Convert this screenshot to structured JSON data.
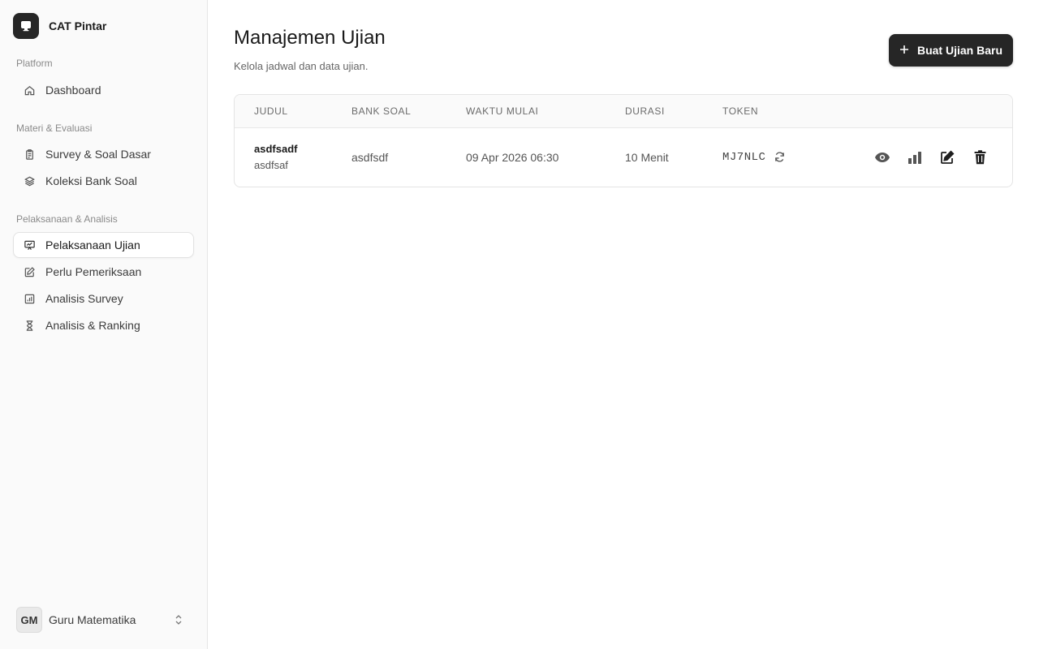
{
  "app": {
    "name": "CAT Pintar"
  },
  "sidebar": {
    "sections": [
      {
        "title": "Platform",
        "items": [
          {
            "label": "Dashboard",
            "icon": "home-icon"
          }
        ]
      },
      {
        "title": "Materi & Evaluasi",
        "items": [
          {
            "label": "Survey & Soal Dasar",
            "icon": "clipboard-icon"
          },
          {
            "label": "Koleksi Bank Soal",
            "icon": "layers-icon"
          }
        ]
      },
      {
        "title": "Pelaksanaan & Analisis",
        "items": [
          {
            "label": "Pelaksanaan Ujian",
            "icon": "presentation-icon",
            "active": true
          },
          {
            "label": "Perlu Pemeriksaan",
            "icon": "pencil-icon"
          },
          {
            "label": "Analisis Survey",
            "icon": "bar-chart-icon"
          },
          {
            "label": "Analisis & Ranking",
            "icon": "hourglass-icon"
          }
        ]
      }
    ]
  },
  "user": {
    "initials": "GM",
    "name": "Guru Matematika"
  },
  "page": {
    "title": "Manajemen Ujian",
    "subtitle": "Kelola jadwal dan data ujian.",
    "new_button": "Buat Ujian Baru"
  },
  "table": {
    "headers": [
      "JUDUL",
      "BANK SOAL",
      "WAKTU MULAI",
      "DURASI",
      "TOKEN"
    ],
    "rows": [
      {
        "title": "asdfsadf",
        "subtitle": "asdfsaf",
        "bank_soal": "asdfsdf",
        "waktu_mulai": "09 Apr 2026 06:30",
        "durasi": "10 Menit",
        "token": "MJ7NLC"
      }
    ]
  },
  "colors": {
    "primary": "#262626",
    "sidebar_bg": "#fafafa",
    "border": "#e4e4e4"
  }
}
